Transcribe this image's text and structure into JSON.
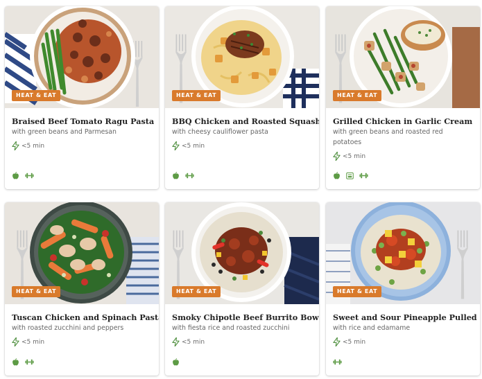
{
  "colors": {
    "badge": "#d97a2b",
    "icon_green": "#4f8f3f"
  },
  "cards": [
    {
      "badge": "HEAT & EAT",
      "title": "Braised Beef Tomato Ragu Pasta",
      "subtitle": "with green beans and Parmesan",
      "time": "<5 min",
      "tags": [
        "apple-icon",
        "dumbbell-icon"
      ]
    },
    {
      "badge": "HEAT & EAT",
      "title": "BBQ Chicken and Roasted Squash",
      "subtitle": "with cheesy cauliflower pasta",
      "time": "<5 min",
      "tags": [
        "apple-icon",
        "dumbbell-icon"
      ]
    },
    {
      "badge": "HEAT & EAT",
      "title": "Grilled Chicken in Garlic Cream",
      "subtitle": "with green beans and roasted red potatoes",
      "time": "<5 min",
      "tags": [
        "apple-icon",
        "scale-icon",
        "dumbbell-icon"
      ]
    },
    {
      "badge": "HEAT & EAT",
      "title": "Tuscan Chicken and Spinach Pasta",
      "subtitle": "with roasted zucchini and peppers",
      "time": "<5 min",
      "tags": [
        "apple-icon",
        "dumbbell-icon"
      ]
    },
    {
      "badge": "HEAT & EAT",
      "title": "Smoky Chipotle Beef Burrito Bowl",
      "subtitle": "with fiesta rice and roasted zucchini",
      "time": "<5 min",
      "tags": [
        "apple-icon"
      ]
    },
    {
      "badge": "HEAT & EAT",
      "title": "Sweet and Sour Pineapple Pulled Pork",
      "subtitle": "with rice and edamame",
      "time": "<5 min",
      "tags": [
        "dumbbell-icon"
      ]
    }
  ]
}
